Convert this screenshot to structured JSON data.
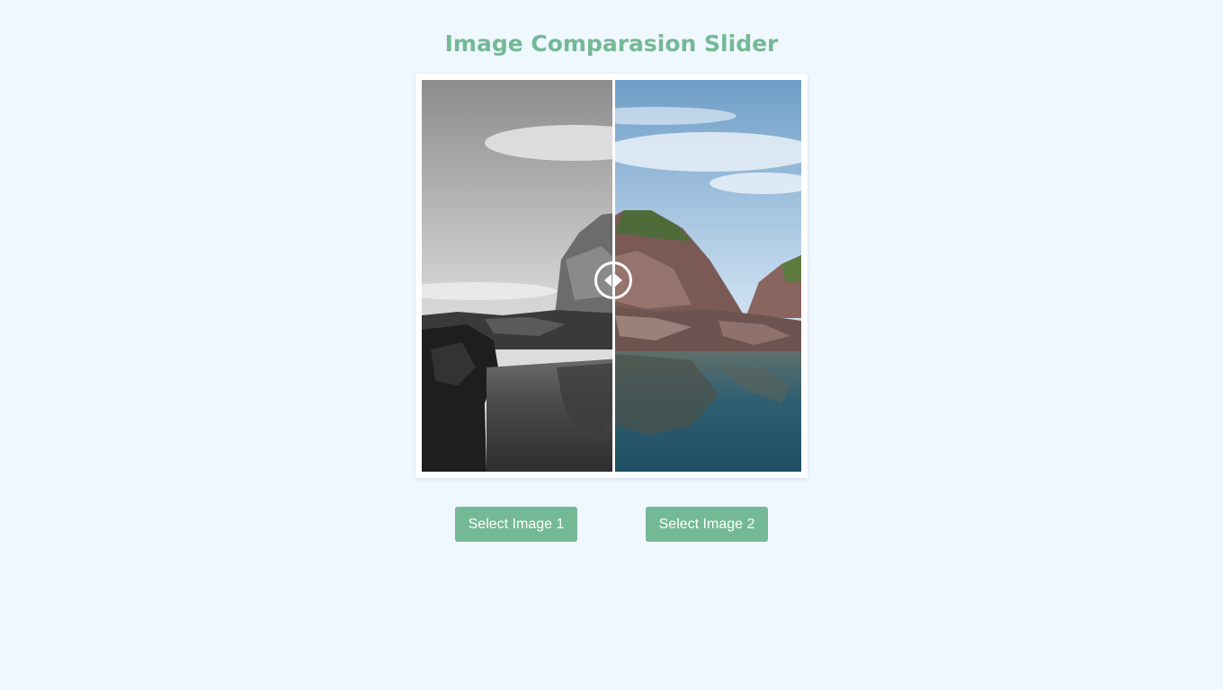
{
  "page": {
    "title": "Image Comparasion Slider"
  },
  "slider": {
    "position_fraction": 0.505,
    "handle_icon": "arrows-left-right-icon",
    "image_left": "grayscale-rocky-coast-photo",
    "image_right": "color-rocky-coast-photo"
  },
  "buttons": {
    "select_image_1": "Select Image 1",
    "select_image_2": "Select Image 2"
  },
  "colors": {
    "background": "#eff7ff",
    "accent": "#74b995",
    "frame": "#ffffff"
  }
}
